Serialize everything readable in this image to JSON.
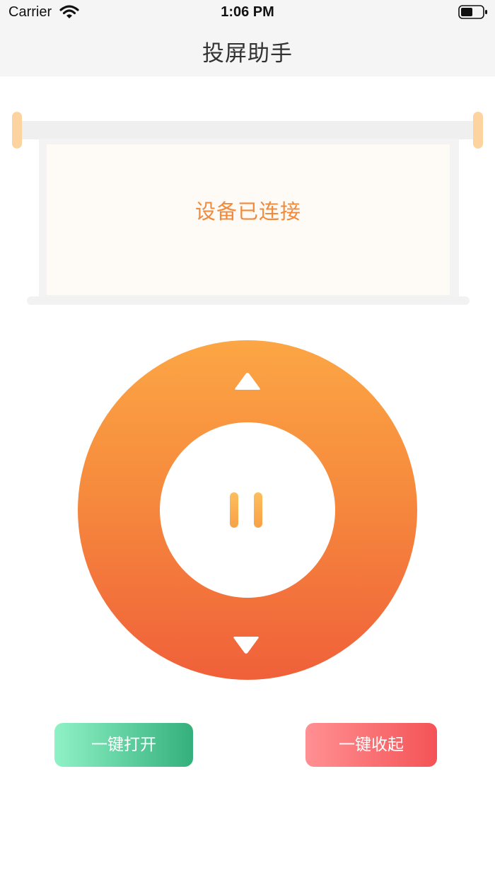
{
  "status_bar": {
    "carrier": "Carrier",
    "time": "1:06 PM",
    "icons": [
      "wifi-icon",
      "battery-icon"
    ]
  },
  "nav": {
    "title": "投屏助手"
  },
  "screen": {
    "status_text": "设备已连接"
  },
  "remote": {
    "up_icon": "triangle-up-icon",
    "down_icon": "triangle-down-icon",
    "center_icon": "pause-icon"
  },
  "buttons": {
    "open_label": "一键打开",
    "close_label": "一键收起"
  },
  "colors": {
    "accent_orange": "#f28a3c",
    "dial_top": "#fca645",
    "dial_bottom": "#f0603a",
    "open_green_start": "#8ff2c6",
    "open_green_end": "#34b07c",
    "close_red_start": "#ff9093",
    "close_red_end": "#f45356"
  }
}
